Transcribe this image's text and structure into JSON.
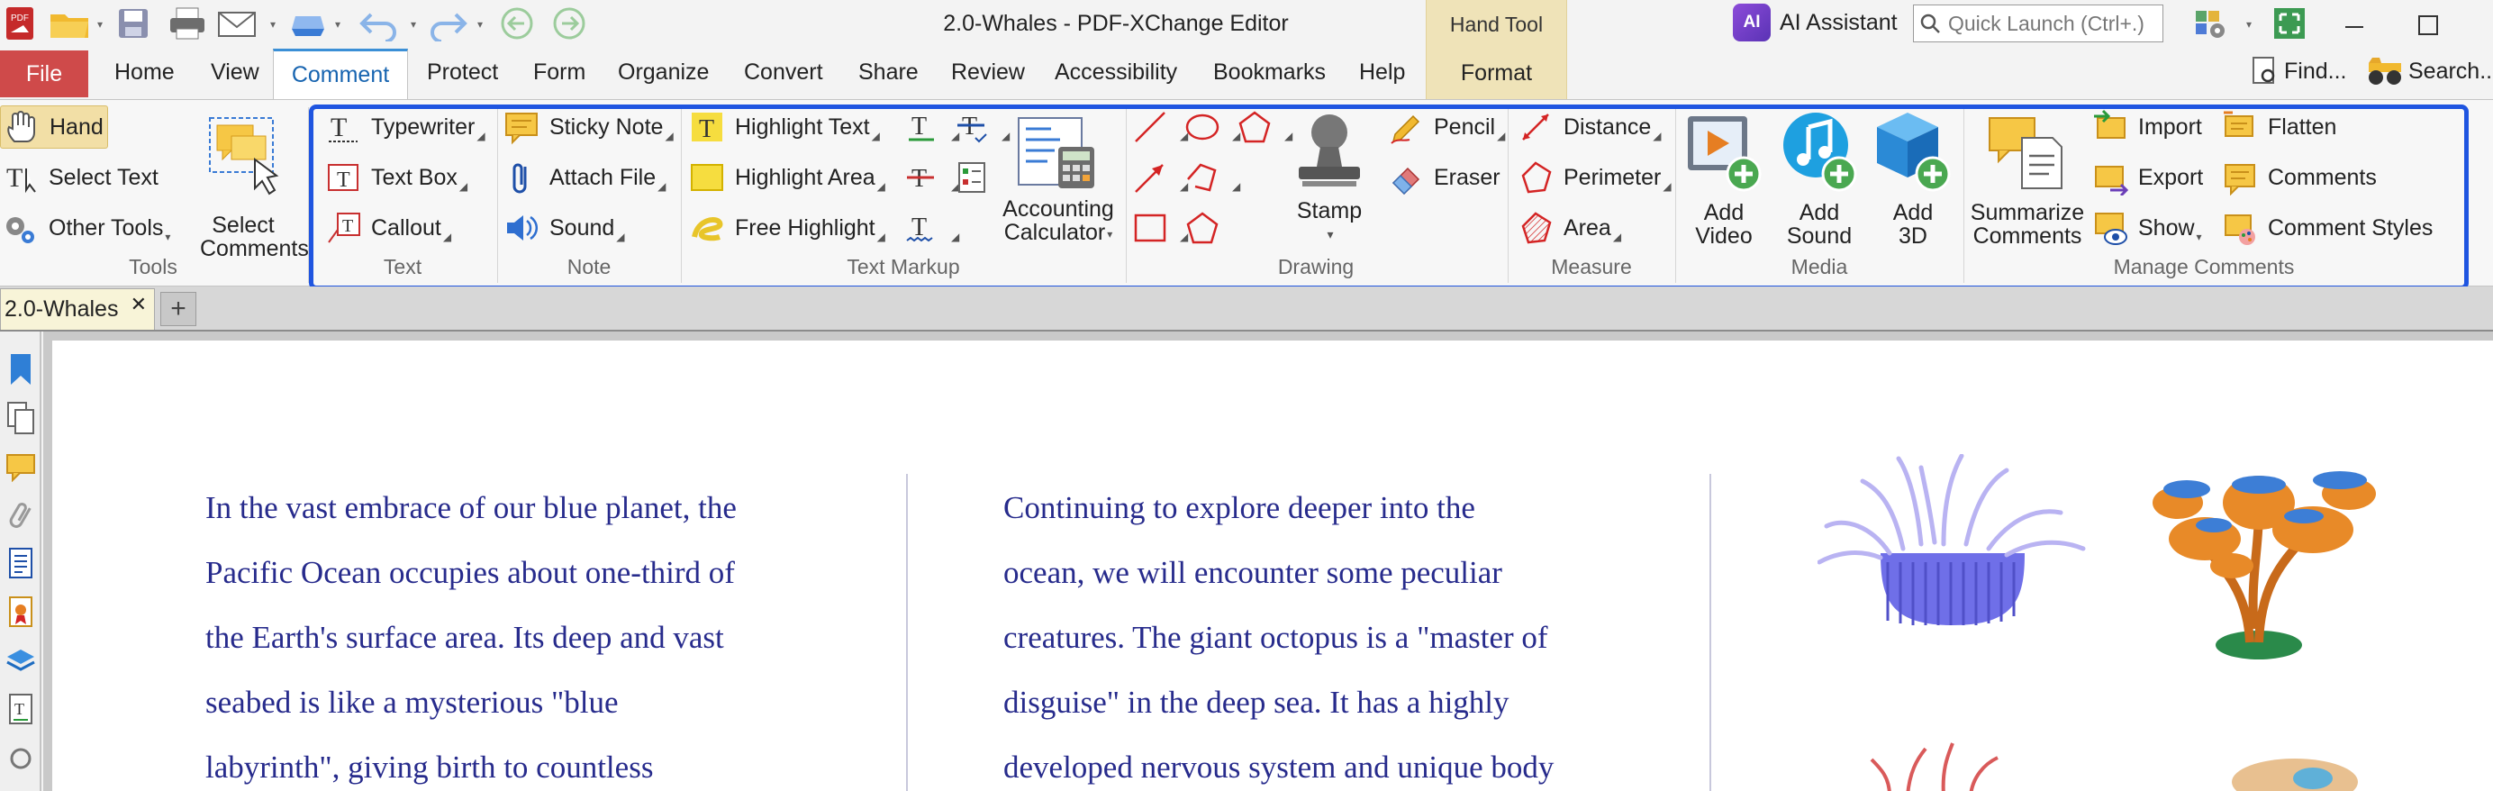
{
  "window": {
    "title": "2.0-Whales - PDF-XChange Editor",
    "context_tab_title": "Hand Tool",
    "context_tab_label": "Format",
    "ai_assistant_label": "AI Assistant",
    "quick_launch_placeholder": "Quick Launch (Ctrl+.)"
  },
  "menu": {
    "file": "File",
    "items": [
      "Home",
      "View",
      "Comment",
      "Protect",
      "Form",
      "Organize",
      "Convert",
      "Share",
      "Review",
      "Accessibility",
      "Bookmarks",
      "Help"
    ],
    "active": "Comment",
    "find_label": "Find...",
    "search_label": "Search..."
  },
  "ribbon": {
    "tools": {
      "hand": "Hand",
      "select_text": "Select Text",
      "other_tools": "Other Tools",
      "select_comments": [
        "Select",
        "Comments"
      ],
      "group": "Tools"
    },
    "text": {
      "typewriter": "Typewriter",
      "text_box": "Text Box",
      "callout": "Callout",
      "group": "Text"
    },
    "note": {
      "sticky_note": "Sticky Note",
      "attach_file": "Attach File",
      "sound": "Sound",
      "group": "Note"
    },
    "markup": {
      "highlight_text": "Highlight Text",
      "highlight_area": "Highlight Area",
      "free_highlight": "Free Highlight",
      "accounting": [
        "Accounting",
        "Calculator"
      ],
      "group": "Text Markup"
    },
    "drawing": {
      "stamp": "Stamp",
      "pencil": "Pencil",
      "eraser": "Eraser",
      "group": "Drawing"
    },
    "measure": {
      "distance": "Distance",
      "perimeter": "Perimeter",
      "area": "Area",
      "group": "Measure"
    },
    "media": {
      "add_video": [
        "Add",
        "Video"
      ],
      "add_sound": [
        "Add",
        "Sound"
      ],
      "add_3d": [
        "Add",
        "3D"
      ],
      "group": "Media"
    },
    "manage": {
      "summarize": [
        "Summarize",
        "Comments"
      ],
      "import": "Import",
      "export": "Export",
      "show": "Show",
      "flatten": "Flatten",
      "comments": "Comments",
      "comment_styles": "Comment Styles",
      "group": "Manage Comments"
    }
  },
  "tabs": {
    "document": "2.0-Whales",
    "new_tab": "+"
  },
  "document": {
    "col1": [
      "In the vast embrace of our blue planet, the",
      "Pacific Ocean occupies about one-third of",
      "the Earth's surface area. Its deep and vast",
      "seabed is like a mysterious \"blue",
      "labyrinth\", giving birth to countless"
    ],
    "col2": [
      "Continuing to explore deeper into the",
      "ocean, we will encounter some peculiar",
      "creatures. The giant octopus is a \"master of",
      "disguise\" in the deep sea. It has a highly",
      "developed nervous system and unique body"
    ]
  },
  "colors": {
    "accent_blue": "#1f55e0",
    "file_red": "#cf4a4a",
    "doc_text": "#272b8c",
    "context_gold": "#efe3b8"
  }
}
